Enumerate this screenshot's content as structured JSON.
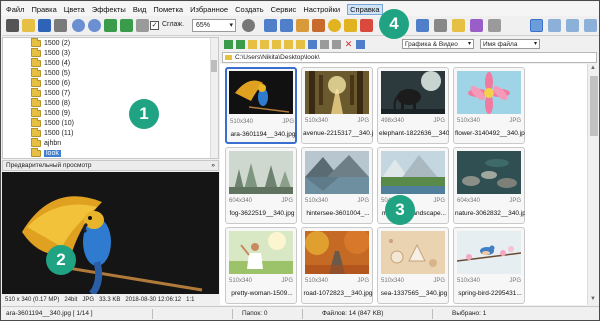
{
  "menu": [
    "Файл",
    "Правка",
    "Цвета",
    "Эффекты",
    "Вид",
    "Пометка",
    "Избранное",
    "Создать",
    "Сервис",
    "Настройки",
    "Справка"
  ],
  "toolbar": {
    "smooth_label": "Сглаж.",
    "smooth_checked": "✓",
    "zoom_value": "65%"
  },
  "tree": {
    "items": [
      "1500 (2)",
      "1500 (3)",
      "1500 (4)",
      "1500 (5)",
      "1500 (6)",
      "1500 (7)",
      "1500 (8)",
      "1500 (9)",
      "1500 (10)",
      "1500 (11)",
      "ajhbn",
      "look"
    ],
    "selected_index": 11
  },
  "preview": {
    "header": "Предварительный просмотр",
    "info": [
      "510 x 340 (0.17 MP)",
      "24bit",
      "JPG",
      "33.3 KB",
      "2018-08-30 12:06:12",
      "1:1"
    ]
  },
  "browser": {
    "address": "C:\\Users\\Nikita\\Desktop\\look\\",
    "filter": "Графика & Видео",
    "sort": "Имя файла"
  },
  "thumbnails": [
    {
      "name": "ara-3601194__340.jpg",
      "dims": "510x340",
      "type": "JPG",
      "selected": true
    },
    {
      "name": "avenue-2215317__340.jpg",
      "dims": "510x340",
      "type": "JPG",
      "selected": false
    },
    {
      "name": "elephant-1822636__340.jpg",
      "dims": "498x340",
      "type": "JPG",
      "selected": false
    },
    {
      "name": "flower-3140492__340.jpg",
      "dims": "510x340",
      "type": "JPG",
      "selected": false
    },
    {
      "name": "fog-3622519__340.jpg",
      "dims": "604x340",
      "type": "JPG",
      "selected": false
    },
    {
      "name": "hintersee-3601004_...",
      "dims": "510x340",
      "type": "JPG",
      "selected": false
    },
    {
      "name": "mountain-landscape...",
      "dims": "504x340",
      "type": "JPG",
      "selected": false
    },
    {
      "name": "nature-3062832__340.jpg",
      "dims": "604x340",
      "type": "JPG",
      "selected": false
    },
    {
      "name": "pretty-woman-1509...",
      "dims": "510x340",
      "type": "JPG",
      "selected": false
    },
    {
      "name": "road-1072823__340.jpg",
      "dims": "510x340",
      "type": "JPG",
      "selected": false
    },
    {
      "name": "sea-1337565__340.jpg",
      "dims": "510x340",
      "type": "JPG",
      "selected": false
    },
    {
      "name": "spring-bird-2295431...",
      "dims": "510x340",
      "type": "JPG",
      "selected": false
    }
  ],
  "status": {
    "file": "ara-3601194__340.jpg [ 1/14 ]",
    "folders": "Папок: 0",
    "files": "Файлов: 14 (847 KB)",
    "selected": "Выбрано: 1"
  },
  "callouts": [
    "1",
    "2",
    "3",
    "4"
  ],
  "colors": {
    "callout": "#1fa383",
    "selection": "#3a6fd0"
  }
}
